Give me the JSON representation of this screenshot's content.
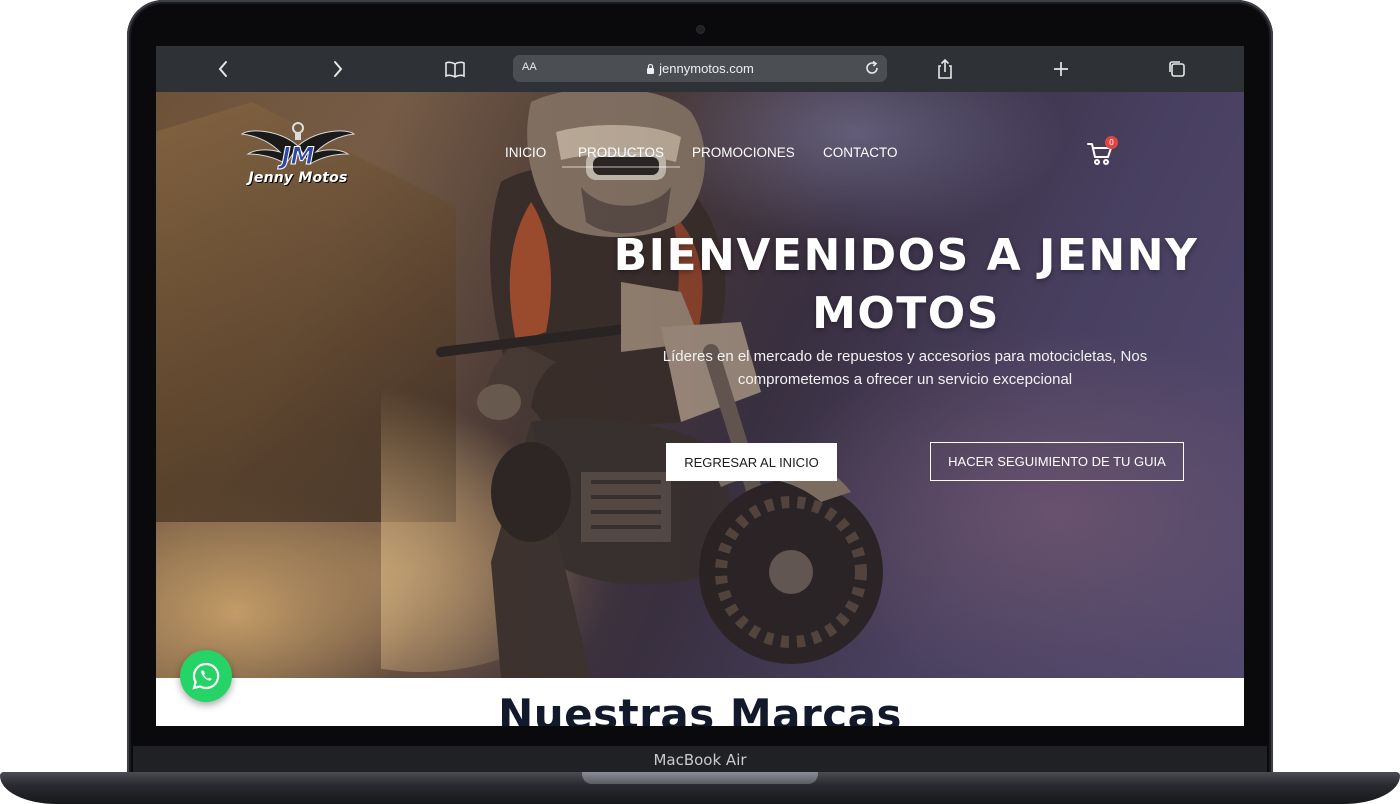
{
  "device": {
    "label": "MacBook Air"
  },
  "browser": {
    "url_aa": "AA",
    "url": "jennymotos.com",
    "icons": [
      "chevron-left-icon",
      "chevron-right-icon",
      "book-icon",
      "lock-icon",
      "reload-icon",
      "share-icon",
      "plus-icon",
      "tabs-icon"
    ]
  },
  "header": {
    "logo_text": "Jenny Motos",
    "logo_mark": "JM",
    "nav": [
      "INICIO",
      "PRODUCTOS",
      "PROMOCIONES",
      "CONTACTO"
    ],
    "cart_count": "0"
  },
  "hero": {
    "title": "BIENVENIDOS A JENNY MOTOS",
    "subtitle": "Líderes en el mercado de repuestos y accesorios para motocicletas, Nos comprometemos a ofrecer un servicio excepcional",
    "button_primary": "REGRESAR AL INICIO",
    "button_secondary": "HACER SEGUIMIENTO DE TU GUIA"
  },
  "brands": {
    "title": "Nuestras Marcas"
  },
  "colors": {
    "whatsapp": "#25d366",
    "badge": "#e04545",
    "heading": "#12192b"
  }
}
